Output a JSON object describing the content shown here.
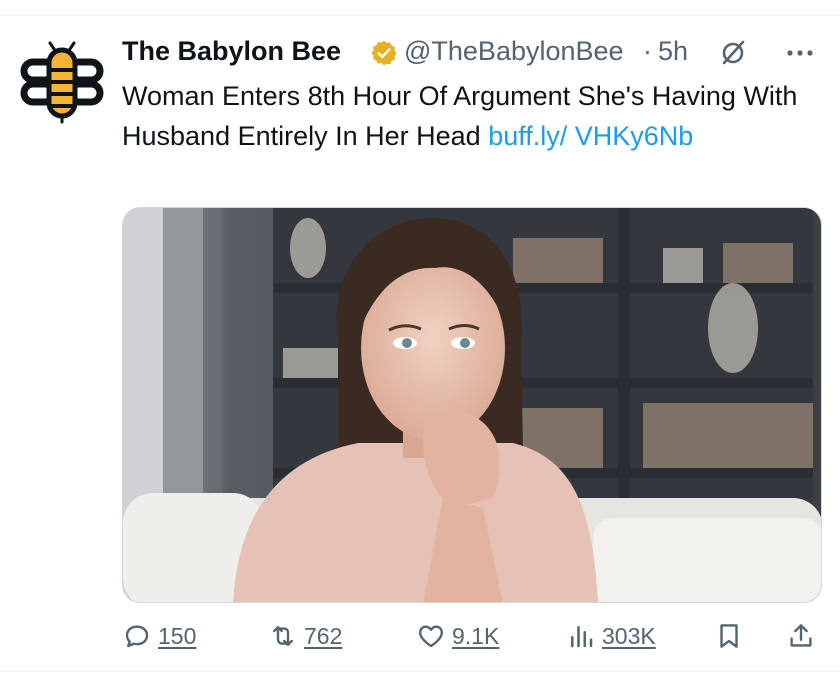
{
  "tweet": {
    "display_name": "The Babylon Bee",
    "handle": "@TheBabylonBee",
    "separator": "·",
    "time": "5h",
    "text_main": "Woman Enters 8th Hour Of Argument She's Having With Husband Entirely In Her Head ",
    "link_text": "buff.ly/ VHKy6Nb",
    "avatar_icon": "babylon-bee-logo",
    "verified": true,
    "media_description_icon": "photo"
  },
  "actions": {
    "replies": "150",
    "retweets": "762",
    "likes": "9.1K",
    "views": "303K"
  },
  "colors": {
    "text": "#0f1419",
    "secondary": "#536471",
    "link": "#1d9bf0",
    "badge": "#e8b021",
    "logo_yellow": "#f5b335"
  }
}
